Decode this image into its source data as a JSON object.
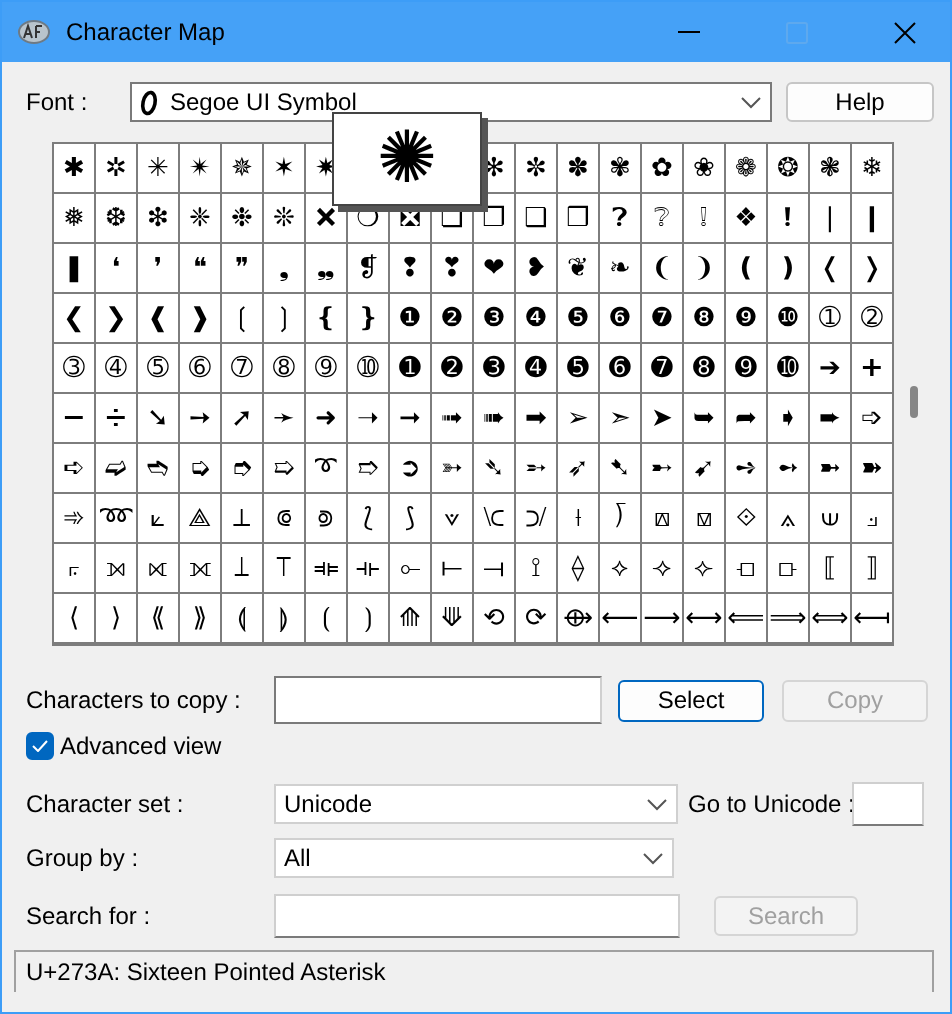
{
  "window": {
    "title": "Character Map"
  },
  "font": {
    "label": "Font :",
    "value": "Segoe UI Symbol"
  },
  "help_button": {
    "label": "Help"
  },
  "grid": {
    "rows": [
      [
        "✱",
        "✲",
        "✳",
        "✴",
        "✵",
        "✶",
        "✷",
        null,
        null,
        null,
        "✻",
        "✼",
        "✽",
        "✾",
        "✿",
        "❀",
        "❁",
        "❂",
        "❃",
        "❄"
      ],
      [
        "❅",
        "❆",
        "❇",
        "❈",
        "❉",
        "❊",
        "❌",
        "❍",
        "❎",
        "❏",
        "❐",
        "❑",
        "❒",
        "❓",
        "❔",
        "❕",
        "❖",
        "❗",
        "❘",
        "❙"
      ],
      [
        "❚",
        "❛",
        "❜",
        "❝",
        "❞",
        "❟",
        "❠",
        "❡",
        "❢",
        "❣",
        "❤",
        "❥",
        "❦",
        "❧",
        "❨",
        "❩",
        "❪",
        "❫",
        "❬",
        "❭"
      ],
      [
        "❮",
        "❯",
        "❰",
        "❱",
        "❲",
        "❳",
        "❴",
        "❵",
        "❶",
        "❷",
        "❸",
        "❹",
        "❺",
        "❻",
        "❼",
        "❽",
        "❾",
        "❿",
        "➀",
        "➁"
      ],
      [
        "➂",
        "➃",
        "➄",
        "➅",
        "➆",
        "➇",
        "➈",
        "➉",
        "➊",
        "➋",
        "➌",
        "➍",
        "➎",
        "➏",
        "➐",
        "➑",
        "➒",
        "➓",
        "➔",
        "➕"
      ],
      [
        "➖",
        "➗",
        "➘",
        "➙",
        "➚",
        "➛",
        "➜",
        "➝",
        "➞",
        "➟",
        "➠",
        "➡",
        "➢",
        "➣",
        "➤",
        "➥",
        "➦",
        "➧",
        "➨",
        "➩"
      ],
      [
        "➪",
        "➫",
        "➬",
        "➭",
        "➮",
        "➯",
        "➰",
        "➱",
        "➲",
        "➳",
        "➴",
        "➵",
        "➶",
        "➷",
        "➸",
        "➹",
        "➺",
        "➻",
        "➼",
        "➽"
      ],
      [
        "➾",
        "➿",
        "⟀",
        "⟁",
        "⟂",
        "⟃",
        "⟄",
        "⟅",
        "⟆",
        "⟇",
        "⟈",
        "⟉",
        "⟊",
        "⟌",
        "⟎",
        "⟏",
        "⟐",
        "⟑",
        "⟒",
        "⟓"
      ],
      [
        "⟔",
        "⟕",
        "⟖",
        "⟗",
        "⟘",
        "⟙",
        "⟚",
        "⟛",
        "⟜",
        "⟝",
        "⟞",
        "⟟",
        "⟠",
        "⟡",
        "⟢",
        "⟣",
        "⟤",
        "⟥",
        "⟦",
        "⟧"
      ],
      [
        "⟨",
        "⟩",
        "⟪",
        "⟫",
        "⟬",
        "⟭",
        "⟮",
        "⟯",
        "⟰",
        "⟱",
        "⟲",
        "⟳",
        "⟴",
        "⟵",
        "⟶",
        "⟷",
        "⟸",
        "⟹",
        "⟺",
        "⟻"
      ]
    ],
    "magnified": "✺"
  },
  "characters_to_copy": {
    "label": "Characters to copy :"
  },
  "select_button": {
    "label": "Select",
    "focused": true
  },
  "copy_button": {
    "label": "Copy",
    "disabled": true
  },
  "advanced_view": {
    "label": "Advanced view",
    "checked": true
  },
  "character_set": {
    "label": "Character set :",
    "value": "Unicode"
  },
  "go_to_unicode": {
    "label": "Go to Unicode :"
  },
  "group_by": {
    "label": "Group by :",
    "value": "All"
  },
  "search_for": {
    "label": "Search for :"
  },
  "search_button": {
    "label": "Search",
    "disabled": true
  },
  "status_bar": {
    "text": "U+273A: Sixteen Pointed Asterisk"
  }
}
